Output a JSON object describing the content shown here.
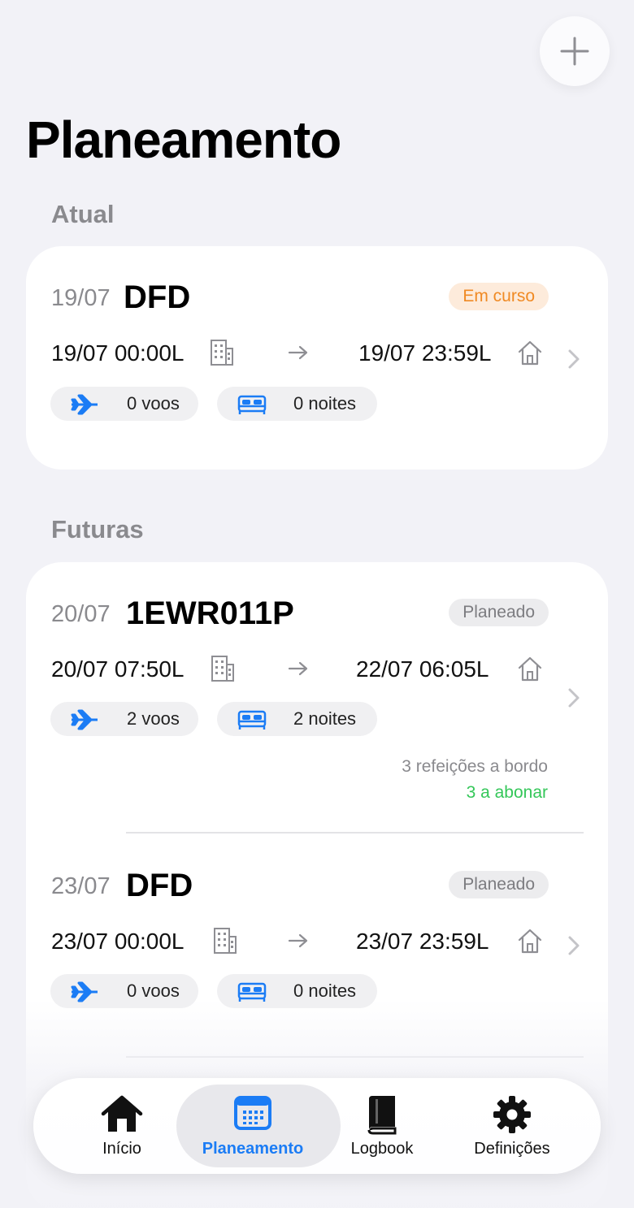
{
  "header": {
    "title": "Planeamento"
  },
  "sections": {
    "current_label": "Atual",
    "future_label": "Futuras"
  },
  "current": {
    "date": "19/07",
    "code": "DFD",
    "status": "Em curso",
    "start_time": "19/07 00:00L",
    "end_time": "19/07 23:59L",
    "flights": "0 voos",
    "nights": "0 noites"
  },
  "future": [
    {
      "date": "20/07",
      "code": "1EWR011P",
      "status": "Planeado",
      "start_time": "20/07 07:50L",
      "end_time": "22/07 06:05L",
      "flights": "2 voos",
      "nights": "2 noites",
      "meals": "3 refeições a bordo",
      "meals_claim": "3 a abonar"
    },
    {
      "date": "23/07",
      "code": "DFD",
      "status": "Planeado",
      "start_time": "23/07 00:00L",
      "end_time": "23/07 23:59L",
      "flights": "0 voos",
      "nights": "0 noites"
    }
  ],
  "tabbar": {
    "tabs": [
      {
        "label": "Início",
        "icon": "home-icon"
      },
      {
        "label": "Planeamento",
        "icon": "calendar-icon"
      },
      {
        "label": "Logbook",
        "icon": "book-icon"
      },
      {
        "label": "Definições",
        "icon": "gear-icon"
      }
    ],
    "active_color": "#1b7cf5"
  },
  "colors": {
    "background": "#f2f2f7",
    "accent_blue": "#1b7cf5",
    "status_orange": "#f08a24",
    "status_green": "#34c759"
  }
}
